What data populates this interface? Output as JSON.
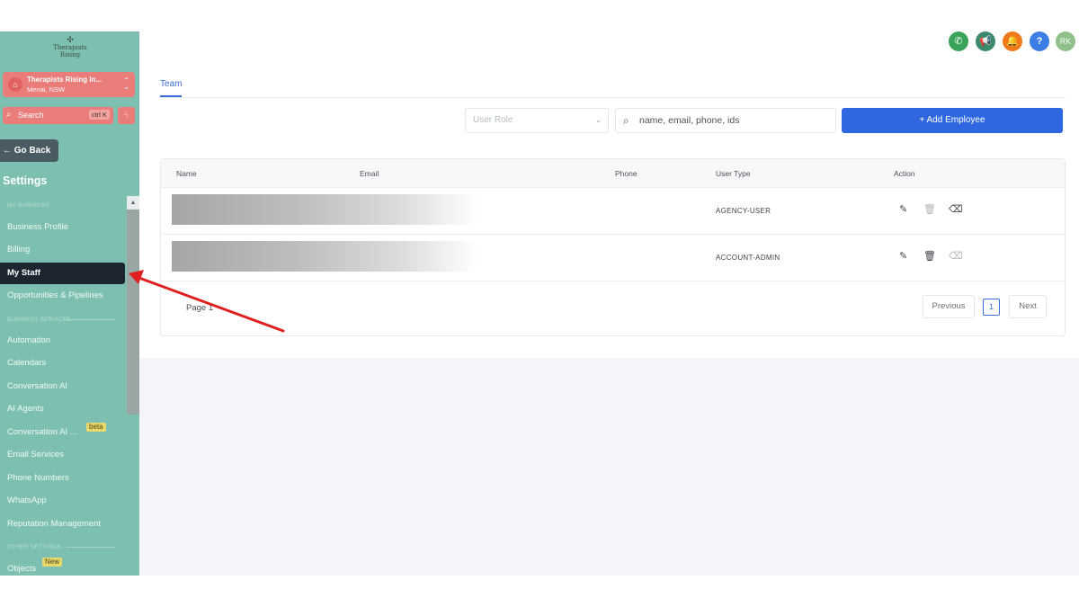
{
  "colors": {
    "sidebar_bg": "#7dbfb0",
    "account_bg": "#ea7d79",
    "active_item_bg": "#1c2530",
    "primary": "#2f67e0",
    "arrow": "#e02020"
  },
  "sidebar": {
    "logo_text": "Therapists Rising",
    "account": {
      "name": "Therapists Rising In...",
      "location": "Menai, NSW",
      "icon": "location-pin-icon"
    },
    "search": {
      "label": "Search",
      "shortcut": "ctrl K",
      "icon": "search-icon"
    },
    "quick_action_icon": "lightning-icon",
    "go_back": "Go Back",
    "title": "Settings",
    "sections": {
      "my_business": "MY BUSINESS",
      "business_services": "BUSINESS SERVICES",
      "other_settings": "OTHER SETTINGS"
    },
    "items": {
      "business_profile": "Business Profile",
      "billing": "Billing",
      "my_staff": "My Staff",
      "opportunities": "Opportunities & Pipelines",
      "automation": "Automation",
      "calendars": "Calendars",
      "conversation_ai": "Conversation AI",
      "ai_agents": "AI Agents",
      "conversation_ai_2": "Conversation AI ...",
      "beta_tag": "beta",
      "email_services": "Email Services",
      "phone_numbers": "Phone Numbers",
      "whatsapp": "WhatsApp",
      "reputation": "Reputation Management",
      "objects": "Objects",
      "new_tag": "New"
    }
  },
  "topbar": {
    "icons": [
      "phone-icon",
      "megaphone-icon",
      "bell-icon",
      "help-icon"
    ],
    "avatar_initials": "RK"
  },
  "main": {
    "tab": "Team",
    "user_role_placeholder": "User Role",
    "search_placeholder": "name, email, phone, ids",
    "add_button": "Add Employee",
    "columns": {
      "name": "Name",
      "email": "Email",
      "phone": "Phone",
      "user_type": "User Type",
      "action": "Action"
    },
    "rows": [
      {
        "user_type": "AGENCY-USER"
      },
      {
        "user_type": "ACCOUNT-ADMIN"
      }
    ],
    "pagination": {
      "label": "Page 1",
      "previous": "Previous",
      "current": "1",
      "next": "Next"
    }
  }
}
